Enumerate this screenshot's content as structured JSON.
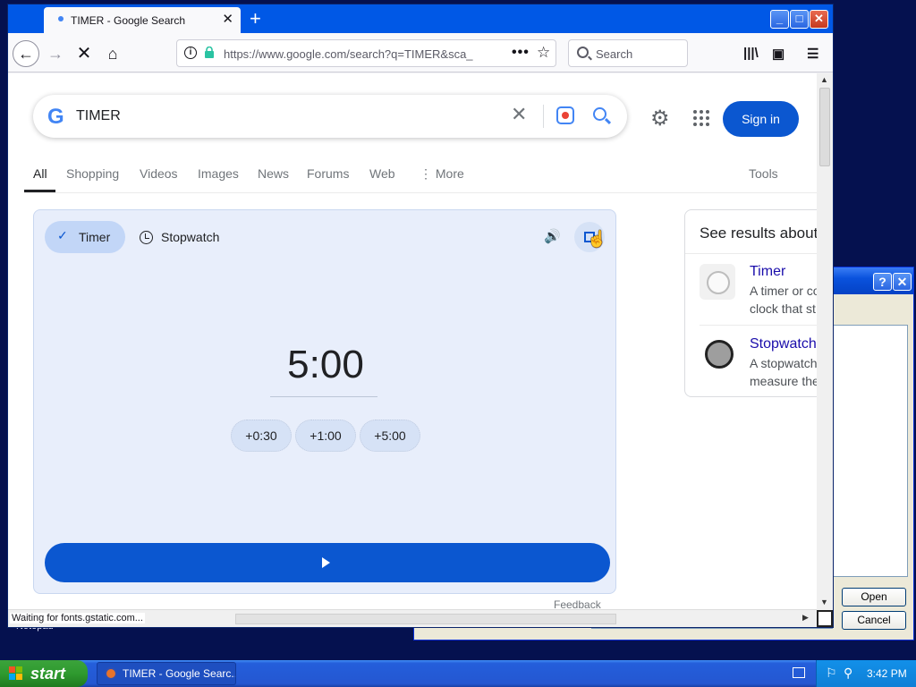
{
  "desktop": {
    "label": "Notepad"
  },
  "dialog": {
    "help_label": "?",
    "close_label": "✕",
    "open_label": "Open",
    "cancel_label": "Cancel"
  },
  "browser": {
    "tab_title": "TIMER - Google Search",
    "new_tab_label": "+",
    "window_controls": {
      "minimize": "_",
      "maximize": "□",
      "close": "✕"
    },
    "url": "https://www.google.com/search?q=TIMER&sca_",
    "search_placeholder": "Search",
    "status_text": "Waiting for fonts.gstatic.com..."
  },
  "google": {
    "logo": "G",
    "query": "TIMER",
    "signin_label": "Sign in",
    "tabs": [
      "All",
      "Shopping",
      "Videos",
      "Images",
      "News",
      "Forums",
      "Web",
      "⋮ More"
    ],
    "tools_label": "Tools",
    "feedback_label": "Feedback"
  },
  "timer": {
    "mode_timer": "Timer",
    "mode_stopwatch": "Stopwatch",
    "display": "5:00",
    "add_buttons": [
      "+0:30",
      "+1:00",
      "+5:00"
    ]
  },
  "knowledge_panel": {
    "heading": "See results about",
    "items": [
      {
        "name": "Timer",
        "desc_line1": "A timer or co",
        "desc_line2": "clock that st"
      },
      {
        "name": "Stopwatch",
        "desc_line1": "A stopwatch",
        "desc_line2": "measure the"
      }
    ]
  },
  "taskbar": {
    "start_label": "start",
    "task_label": "TIMER - Google Searc...",
    "clock": "3:42 PM"
  },
  "colors": {
    "accent": "#0b57d0",
    "xp_blue": "#0058e6",
    "card_bg": "#e8eefb"
  }
}
